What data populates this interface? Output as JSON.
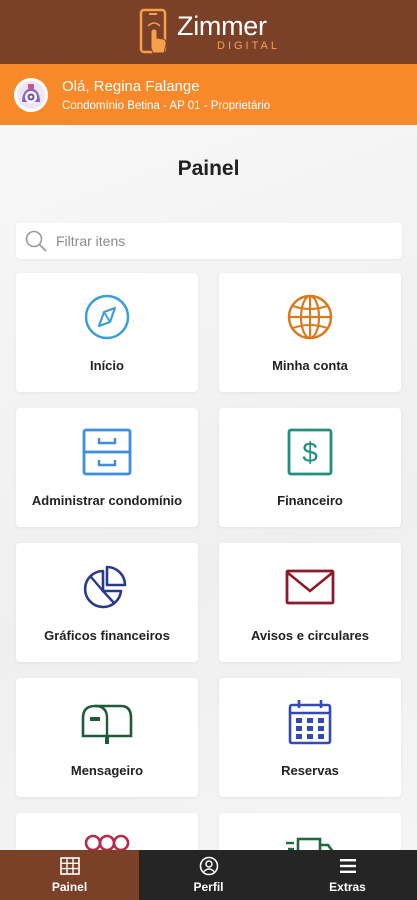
{
  "app": {
    "logo_name": "Zimmer",
    "logo_sub": "DIGITAL",
    "brand_color": "#7a4128",
    "accent_color": "#f7892a"
  },
  "user": {
    "greeting": "Olá, Regina Falange",
    "subline": "Condomínio Betina - AP 01 - Proprietário",
    "avatar_icon": "avatar-icon"
  },
  "page": {
    "title": "Painel"
  },
  "search": {
    "placeholder": "Filtrar itens",
    "value": ""
  },
  "cards": [
    {
      "label": "Início",
      "icon": "compass-icon",
      "color": "#3b9ed8"
    },
    {
      "label": "Minha conta",
      "icon": "globe-icon",
      "color": "#d97a1f"
    },
    {
      "label": "Administrar condomínio",
      "icon": "filing-cabinet-icon",
      "color": "#3b8ee0"
    },
    {
      "label": "Financeiro",
      "icon": "dollar-icon",
      "color": "#22907a"
    },
    {
      "label": "Gráficos financeiros",
      "icon": "pie-chart-icon",
      "color": "#283a8a"
    },
    {
      "label": "Avisos e circulares",
      "icon": "envelope-icon",
      "color": "#8c1a2a"
    },
    {
      "label": "Mensageiro",
      "icon": "mailbox-icon",
      "color": "#1f5a3a"
    },
    {
      "label": "Reservas",
      "icon": "calendar-icon",
      "color": "#3448b8"
    },
    {
      "label": "",
      "icon": "people-icon",
      "color": "#b62a4a"
    },
    {
      "label": "",
      "icon": "truck-icon",
      "color": "#1f6a3a"
    }
  ],
  "bottom_nav": [
    {
      "label": "Painel",
      "icon": "grid-icon",
      "active": true
    },
    {
      "label": "Perfil",
      "icon": "user-circle-icon",
      "active": false
    },
    {
      "label": "Extras",
      "icon": "menu-icon",
      "active": false
    }
  ]
}
